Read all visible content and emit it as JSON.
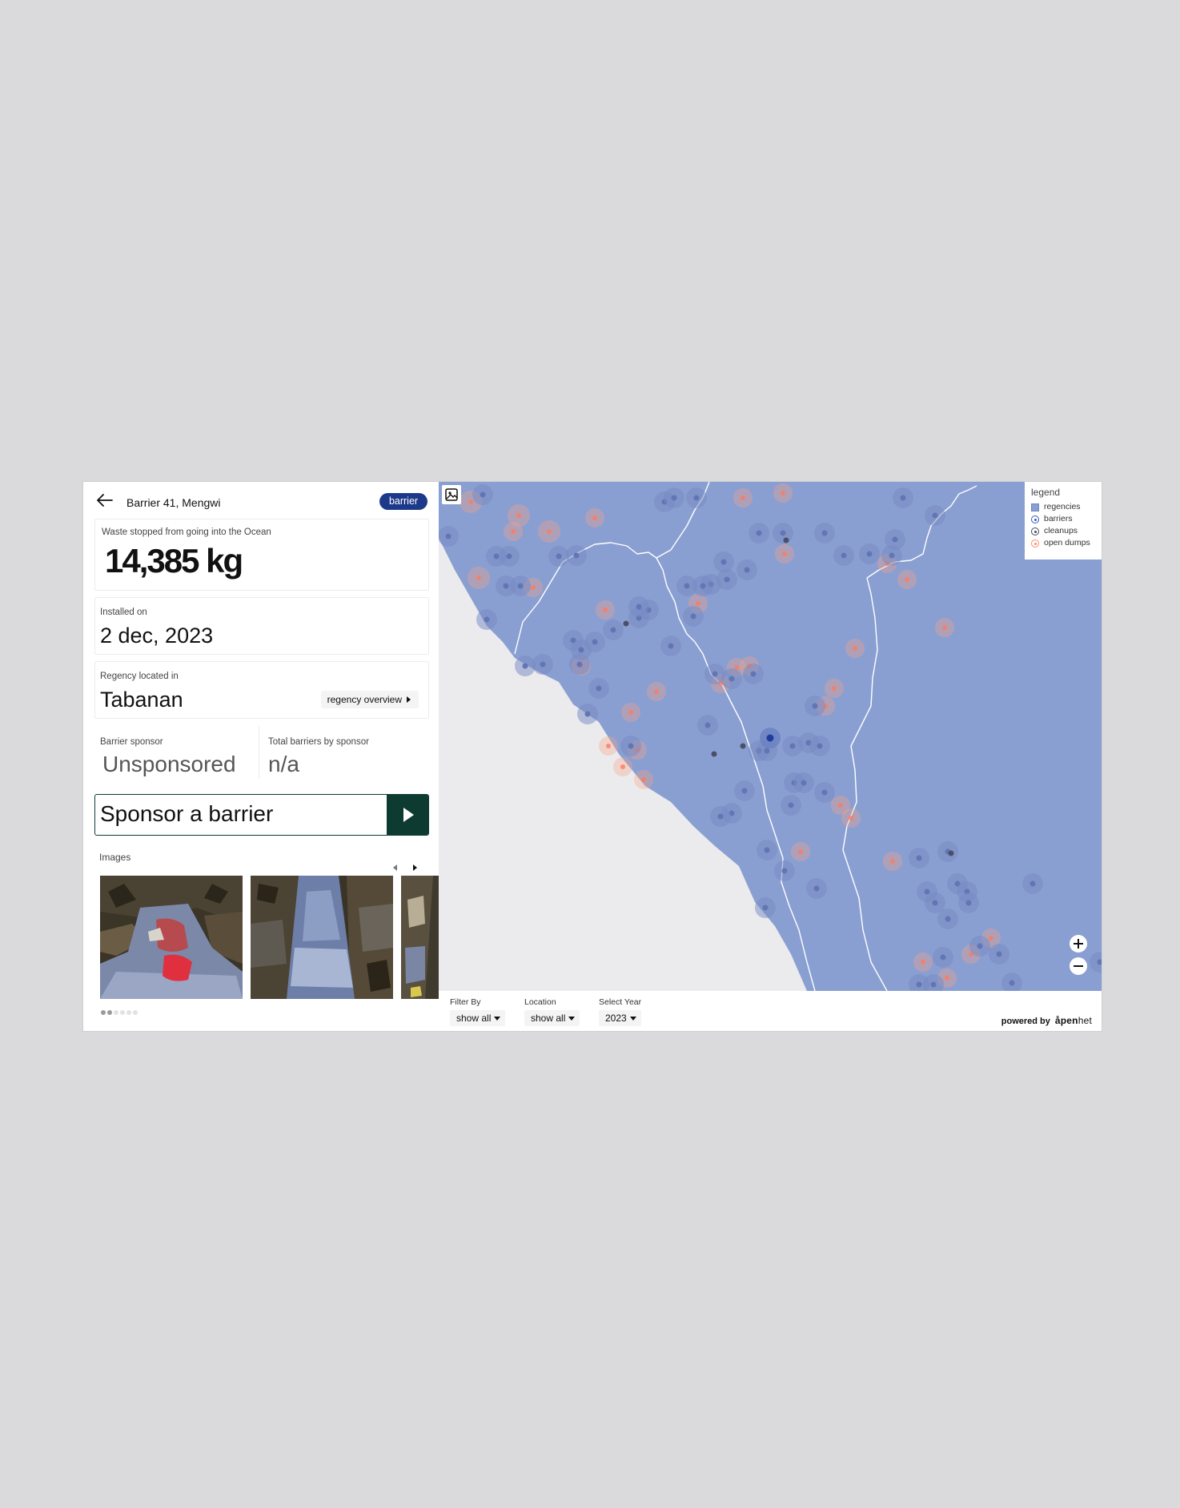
{
  "header": {
    "title": "Barrier 41, Mengwi",
    "badge": "barrier"
  },
  "waste": {
    "label": "Waste stopped from going into the Ocean",
    "value": "14,385 kg"
  },
  "installed": {
    "label": "Installed on",
    "value": "2 dec, 2023"
  },
  "regency": {
    "label": "Regency located in",
    "value": "Tabanan",
    "button": "regency overview"
  },
  "sponsor": {
    "label": "Barrier sponsor",
    "value": "Unsponsored",
    "total_label": "Total barriers by sponsor",
    "total_value": "n/a"
  },
  "cta": {
    "label": "Sponsor a barrier"
  },
  "images": {
    "label": "Images",
    "count": 6,
    "active_index": 1
  },
  "legend": {
    "title": "legend",
    "items": [
      {
        "label": "regencies",
        "color": "#8a9fd1"
      },
      {
        "label": "barriers",
        "color": "#3a5ab8"
      },
      {
        "label": "cleanups",
        "color": "#444a5e"
      },
      {
        "label": "open dumps",
        "color": "#ff8a6a"
      }
    ]
  },
  "filters": {
    "filter_by": {
      "label": "Filter By",
      "value": "show all"
    },
    "location": {
      "label": "Location",
      "value": "show all"
    },
    "year": {
      "label": "Select Year",
      "value": "2023"
    }
  },
  "footer": {
    "powered_by": "powered by",
    "brand_a": "å",
    "brand_b": "pen",
    "brand_c": "het"
  },
  "colors": {
    "map_fill": "#8a9fd1",
    "land": "#ebebed",
    "badge": "#1d3a8a",
    "cta": "#0d3b32",
    "barrier_dot": "#6b7fbf",
    "selected_dot": "#2040a0",
    "open_dump": "#ff7b5c"
  }
}
